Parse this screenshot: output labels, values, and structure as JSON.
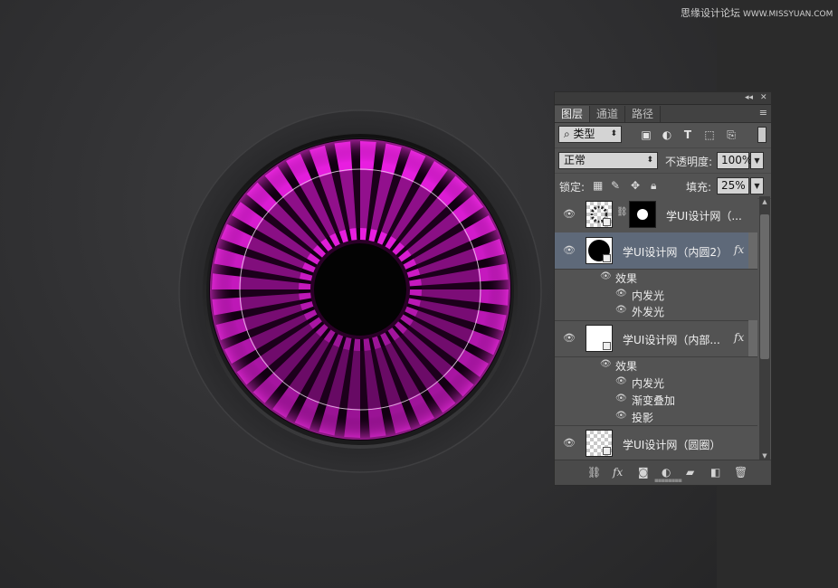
{
  "watermark": {
    "text": "思缘设计论坛",
    "url": "WWW.MISSYUAN.COM"
  },
  "panel": {
    "controls": {
      "collapse": "◂◂",
      "close": "✕"
    },
    "tabs": [
      "图层",
      "通道",
      "路径"
    ],
    "menu_icon": "≡",
    "filter": {
      "label": "类型",
      "icons": [
        "image-filter-icon",
        "adjustment-filter-icon",
        "type-filter-icon",
        "shape-filter-icon",
        "smart-object-filter-icon"
      ]
    },
    "blend_mode": "正常",
    "opacity_label": "不透明度:",
    "opacity_value": "100%",
    "lock_label": "锁定:",
    "fill_label": "填充:",
    "fill_value": "25%",
    "layers": [
      {
        "name": "学UI设计网（...",
        "selected": false,
        "has_mask": true
      },
      {
        "name": "学UI设计网（内圆2）",
        "selected": true,
        "fx": "fx",
        "effects_label": "效果",
        "effects": [
          "内发光",
          "外发光"
        ]
      },
      {
        "name": "学UI设计网（内部...",
        "selected": false,
        "fx": "fx",
        "effects_label": "效果",
        "effects": [
          "内发光",
          "渐变叠加",
          "投影"
        ]
      },
      {
        "name": "学UI设计网（圆圈）",
        "selected": false
      }
    ]
  },
  "colors": {
    "accent": "#e81ee0",
    "selected_row": "#5e6979",
    "panel_bg": "#535353"
  }
}
